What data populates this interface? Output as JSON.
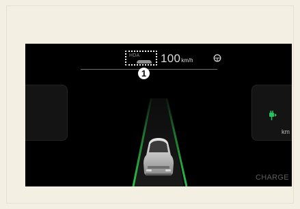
{
  "hda": {
    "label": "HDA",
    "callout_number": "1"
  },
  "speed": {
    "value": "100",
    "unit": "km/h"
  },
  "right_panel": {
    "unit": "km",
    "mode_label": "CHARGE"
  },
  "colors": {
    "background": "#f3efe3",
    "screen": "#000000",
    "lane_green": "#2fbf4a",
    "charge_green": "#22c55e"
  },
  "icons": [
    "steering-wheel-icon",
    "ev-plug-icon",
    "car-icon"
  ]
}
